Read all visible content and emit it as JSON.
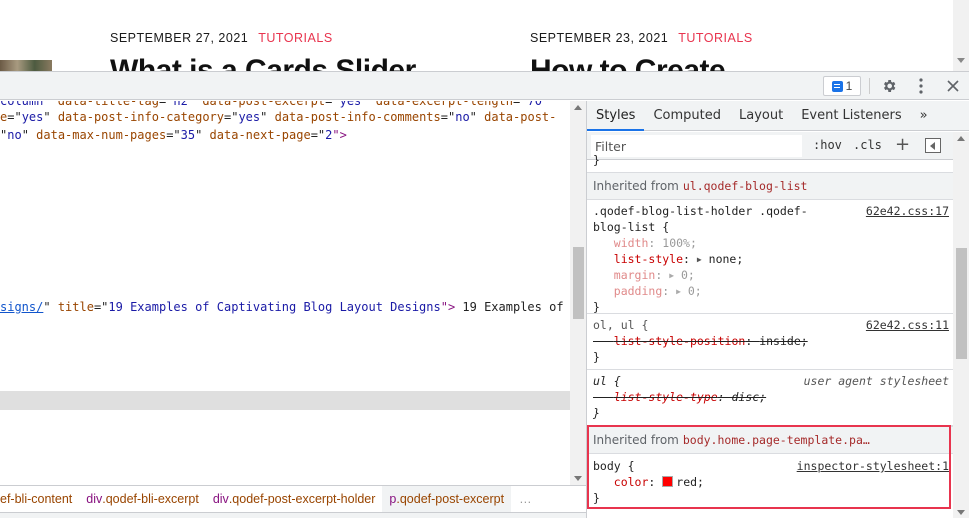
{
  "webpage": {
    "posts": [
      {
        "date": "SEPTEMBER 27, 2021",
        "category": "TUTORIALS",
        "title": "What is a Cards Slider"
      },
      {
        "date": "SEPTEMBER 23, 2021",
        "category": "TUTORIALS",
        "title": "How to Create"
      }
    ]
  },
  "toolbar": {
    "issues_count": "1",
    "icons": [
      "issues-icon",
      "gear-icon",
      "more-vert-icon",
      "close-icon"
    ]
  },
  "elements": {
    "lines": [
      {
        "parts": [
          {
            "t": "column\" ",
            "c": "attr-val"
          },
          {
            "t": "data-title-tag",
            "c": "attr-name"
          },
          {
            "t": "=\"",
            "c": ""
          },
          {
            "t": "h2",
            "c": "attr-val"
          },
          {
            "t": "\" ",
            "c": ""
          },
          {
            "t": "data-post-excerpt",
            "c": "attr-name"
          },
          {
            "t": "=\"",
            "c": ""
          },
          {
            "t": "yes",
            "c": "attr-val"
          },
          {
            "t": "\" ",
            "c": ""
          },
          {
            "t": "data-excerpt-length",
            "c": "attr-name"
          },
          {
            "t": "=\"",
            "c": ""
          },
          {
            "t": "70",
            "c": "attr-val"
          }
        ]
      },
      {
        "parts": [
          {
            "t": "e",
            "c": "attr-name"
          },
          {
            "t": "=\"",
            "c": ""
          },
          {
            "t": "yes",
            "c": "attr-val"
          },
          {
            "t": "\" ",
            "c": ""
          },
          {
            "t": "data-post-info-category",
            "c": "attr-name"
          },
          {
            "t": "=\"",
            "c": ""
          },
          {
            "t": "yes",
            "c": "attr-val"
          },
          {
            "t": "\" ",
            "c": ""
          },
          {
            "t": "data-post-info-comments",
            "c": "attr-name"
          },
          {
            "t": "=\"",
            "c": ""
          },
          {
            "t": "no",
            "c": "attr-val"
          },
          {
            "t": "\" ",
            "c": ""
          },
          {
            "t": "data-post-",
            "c": "attr-name"
          }
        ]
      },
      {
        "parts": [
          {
            "t": "\"",
            "c": ""
          },
          {
            "t": "no",
            "c": "attr-val"
          },
          {
            "t": "\" ",
            "c": ""
          },
          {
            "t": "data-max-num-pages",
            "c": "attr-name"
          },
          {
            "t": "=\"",
            "c": ""
          },
          {
            "t": "35",
            "c": "attr-val"
          },
          {
            "t": "\" ",
            "c": ""
          },
          {
            "t": "data-next-page",
            "c": "attr-name"
          },
          {
            "t": "=\"",
            "c": ""
          },
          {
            "t": "2",
            "c": "attr-val"
          },
          {
            "t": "\">",
            "c": "tag"
          }
        ]
      },
      {
        "parts": [
          {
            "t": "signs/",
            "c": "link"
          },
          {
            "t": "\" ",
            "c": ""
          },
          {
            "t": "title",
            "c": "attr-name"
          },
          {
            "t": "=\"",
            "c": ""
          },
          {
            "t": "19 Examples of Captivating Blog Layout Designs",
            "c": "attr-val"
          },
          {
            "t": "\">",
            "c": "tag"
          },
          {
            "t": " 19 Examples of",
            "c": ""
          }
        ]
      }
    ]
  },
  "breadcrumb": [
    {
      "tag": "",
      "cls": "ef-bli-content"
    },
    {
      "tag": "div",
      "cls": ".qodef-bli-excerpt"
    },
    {
      "tag": "div",
      "cls": ".qodef-post-excerpt-holder"
    },
    {
      "tag": "p",
      "cls": ".qodef-post-excerpt",
      "active": true
    }
  ],
  "breadcrumb_more": "…",
  "styles": {
    "tabs": [
      "Styles",
      "Computed",
      "Layout",
      "Event Listeners"
    ],
    "tabs_overflow": "»",
    "filter_placeholder": "Filter",
    "hov": ":hov",
    "cls": ".cls",
    "plus": "+",
    "top_brace": "}",
    "inherited_1_label": "Inherited from",
    "inherited_1_selector": "ul.qodef-blog-list",
    "rule_1": {
      "selector_line1": ".qodef-blog-list-holder .qodef-",
      "selector_line2": "blog-list {",
      "source": "62e42.css:17",
      "props": [
        {
          "name": "width",
          "value": "100%;",
          "dim": true,
          "tri": false
        },
        {
          "name": "list-style",
          "value": "none;",
          "dim": false,
          "tri": true
        },
        {
          "name": "margin",
          "value": "0;",
          "dim": true,
          "tri": true
        },
        {
          "name": "padding",
          "value": "0;",
          "dim": true,
          "tri": true
        }
      ],
      "close": "}"
    },
    "rule_2": {
      "selector": "ol, ul {",
      "source": "62e42.css:11",
      "prop": "list-style-position",
      "value": "inside;",
      "close": "}"
    },
    "rule_3": {
      "selector": "ul {",
      "source": "user agent stylesheet",
      "prop": "list-style-type",
      "value": "disc;",
      "close": "}"
    },
    "inherited_2_label": "Inherited from",
    "inherited_2_selector": "body.home.page-template.pa…",
    "rule_4": {
      "selector": "body {",
      "source": "inspector-stylesheet:1",
      "prop": "color",
      "value": "red;",
      "swatch_color": "#ff0000",
      "close": "}"
    }
  },
  "colors": {
    "accent": "#1a73e8",
    "highlight_border": "#e8344e",
    "category": "#e8344e"
  }
}
